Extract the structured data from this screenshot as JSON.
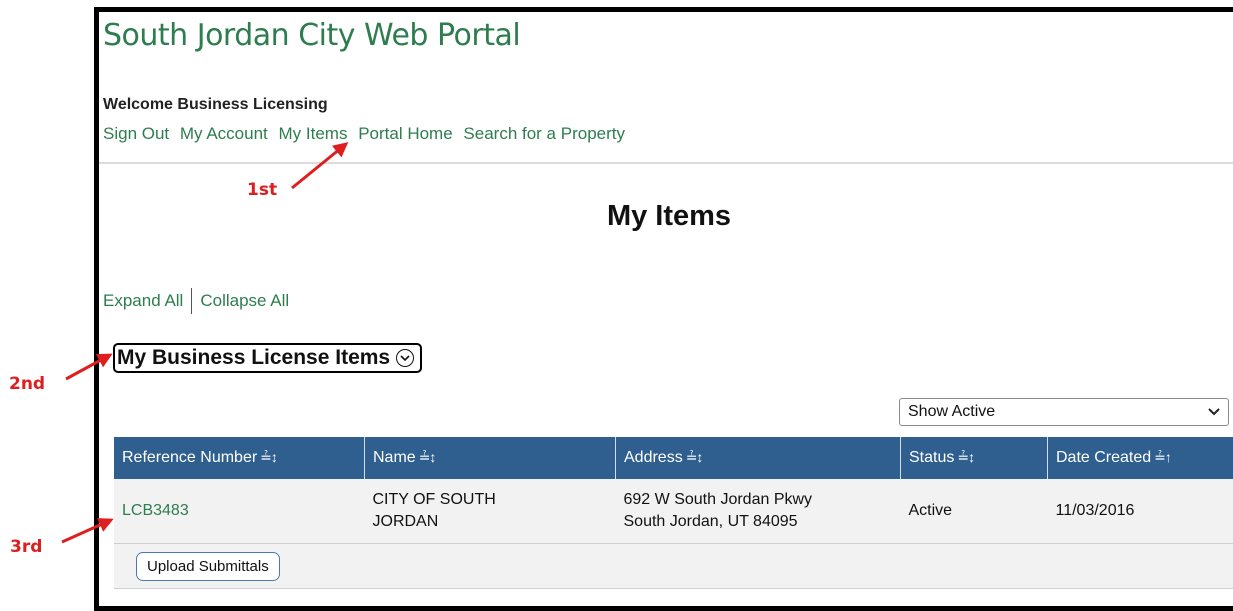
{
  "header": {
    "portal_title": "South Jordan City Web Portal",
    "welcome": "Welcome Business Licensing"
  },
  "nav": {
    "links": [
      "Sign Out",
      "My Account",
      "My Items",
      "Portal Home",
      "Search for a Property"
    ]
  },
  "page": {
    "title": "My Items",
    "expand_all": "Expand All",
    "collapse_all": "Collapse All"
  },
  "section": {
    "title": "My Business License Items"
  },
  "filter": {
    "selected": "Show Active"
  },
  "table": {
    "columns": [
      "Reference Number",
      "Name",
      "Address",
      "Status",
      "Date Created"
    ],
    "rows": [
      {
        "reference": "LCB3483",
        "name_line1": "CITY OF SOUTH",
        "name_line2": "JORDAN",
        "address_line1": "692 W South Jordan Pkwy",
        "address_line2": "South Jordan, UT 84095",
        "status": "Active",
        "date_created": "11/03/2016"
      }
    ],
    "action_label": "Upload Submittals"
  },
  "annotations": {
    "first": "1st",
    "second": "2nd",
    "third": "3rd",
    "color": "#dd1f1f"
  },
  "icons": {
    "sort": "sort-icon",
    "collapse": "chevron-circle-icon",
    "dropdown": "chevron-down-icon"
  },
  "colors": {
    "link": "#2e7d4f",
    "table_header": "#2f5f8f"
  }
}
